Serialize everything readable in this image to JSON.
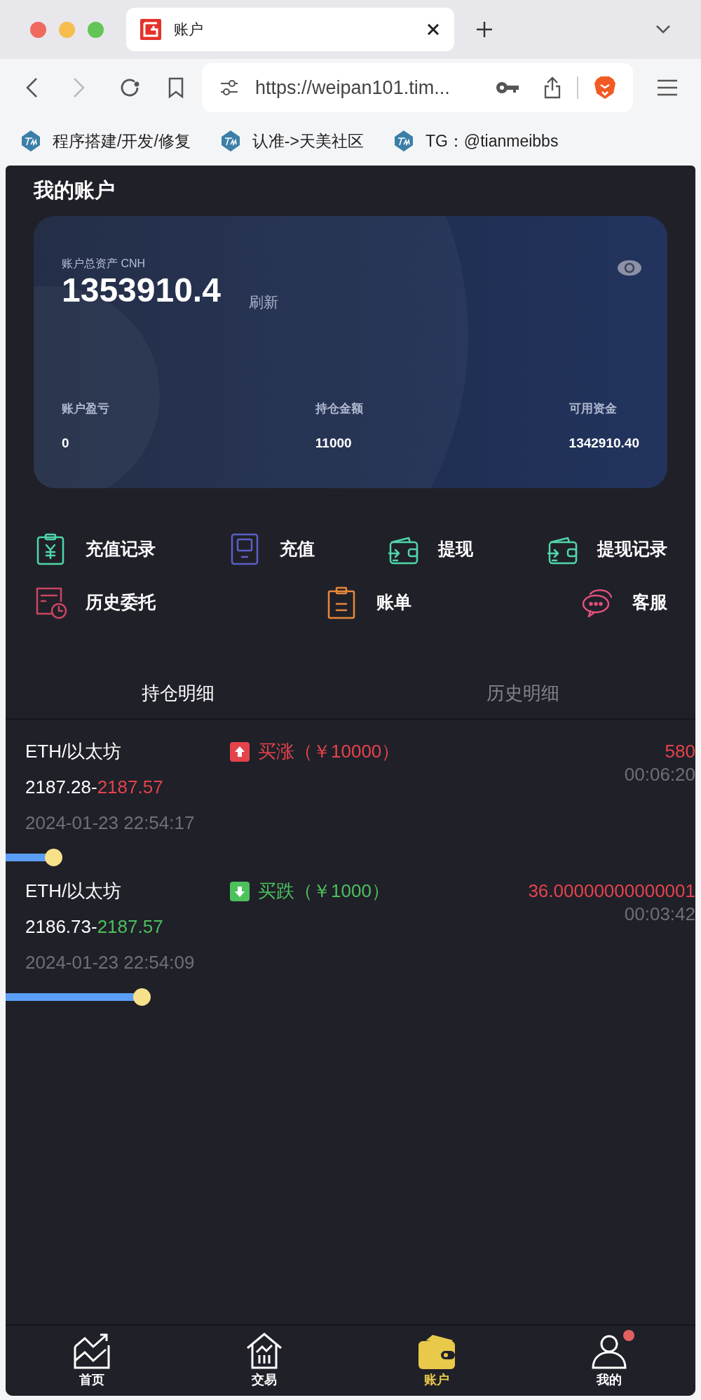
{
  "browser": {
    "tab_title": "账户",
    "address": "https://weipan101.tim...",
    "bookmarks": [
      {
        "label": "程序搭建/开发/修复"
      },
      {
        "label": "认准->天美社区"
      },
      {
        "label": "TG：@tianmeibbs"
      }
    ]
  },
  "page_title": "我的账户",
  "account_card": {
    "total_label": "账户总资产 CNH",
    "total": "1353910.4",
    "refresh": "刷新",
    "stats": [
      {
        "label": "账户盈亏",
        "value": "0"
      },
      {
        "label": "持仓金额",
        "value": "11000"
      },
      {
        "label": "可用资金",
        "value": "1342910.40"
      }
    ]
  },
  "shortcut_rows": [
    [
      {
        "label": "充值记录",
        "kind": "receipt"
      },
      {
        "label": "充值",
        "kind": "tablet"
      },
      {
        "label": "提现",
        "kind": "wallet"
      },
      {
        "label": "提现记录",
        "kind": "wallet"
      }
    ],
    [
      {
        "label": "历史委托",
        "kind": "schedule"
      },
      {
        "label": "账单",
        "kind": "bill"
      },
      {
        "label": "客服",
        "kind": "chat"
      }
    ]
  ],
  "tabs": [
    {
      "label": "持仓明细",
      "selected": true
    },
    {
      "label": "历史明细",
      "selected": false
    }
  ],
  "positions": [
    {
      "symbol": "ETH/以太坊",
      "kind": "up",
      "order": "买涨（￥10000）",
      "open_price": "2187.28-",
      "current_price": "2187.57",
      "profit": "580",
      "duration": "00:06:20",
      "time": "2024-01-23 22:54:17"
    },
    {
      "symbol": "ETH/以太坊",
      "kind": "down",
      "order": "买跌（￥1000）",
      "open_price": "2186.73-",
      "current_price": "2187.57",
      "profit": "36.00000000000001",
      "duration": "00:03:42",
      "time": "2024-01-23 22:54:09"
    }
  ],
  "nav": [
    {
      "label": "首页",
      "kind": "home",
      "selected": false,
      "badge": false
    },
    {
      "label": "交易",
      "kind": "trade",
      "selected": false,
      "badge": false
    },
    {
      "label": "账户",
      "kind": "account",
      "selected": true,
      "badge": false
    },
    {
      "label": "我的",
      "kind": "me",
      "selected": false,
      "badge": true
    }
  ]
}
